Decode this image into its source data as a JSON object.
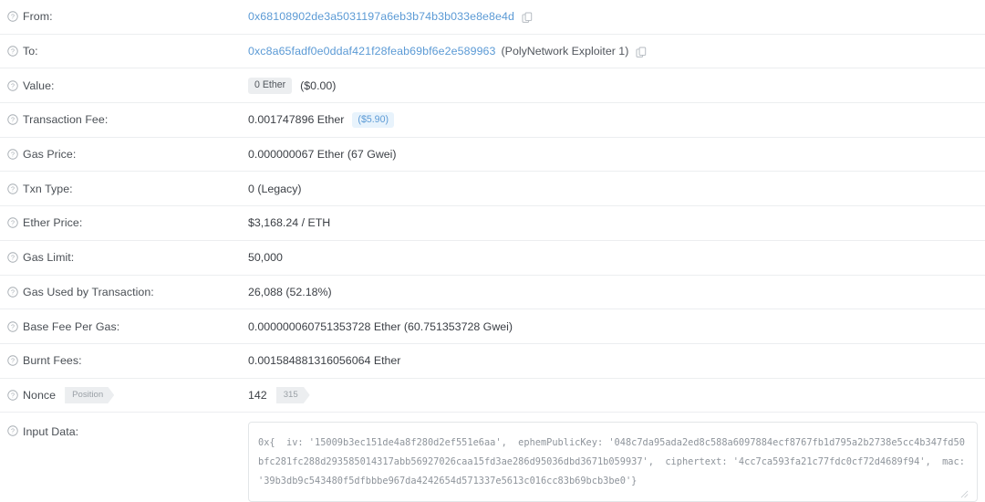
{
  "icons": {
    "help": "question-circle-icon",
    "copy": "copy-icon"
  },
  "rows": {
    "from": {
      "label": "From:",
      "address": "0x68108902de3a5031197a6eb3b74b3b033e8e8e4d"
    },
    "to": {
      "label": "To:",
      "address": "0xc8a65fadf0e0ddaf421f28feab69bf6e2e589963",
      "name_tag": "(PolyNetwork Exploiter 1)"
    },
    "value": {
      "label": "Value:",
      "amount_badge": "0 Ether",
      "usd": "($0.00)"
    },
    "transaction_fee": {
      "label": "Transaction Fee:",
      "amount": "0.001747896 Ether",
      "usd_badge": "($5.90)"
    },
    "gas_price": {
      "label": "Gas Price:",
      "value": "0.000000067 Ether (67 Gwei)"
    },
    "txn_type": {
      "label": "Txn Type:",
      "value": "0 (Legacy)"
    },
    "ether_price": {
      "label": "Ether Price:",
      "value": "$3,168.24 / ETH"
    },
    "gas_limit": {
      "label": "Gas Limit:",
      "value": "50,000"
    },
    "gas_used": {
      "label": "Gas Used by Transaction:",
      "value": "26,088 (52.18%)"
    },
    "base_fee": {
      "label": "Base Fee Per Gas:",
      "value": "0.000000060751353728 Ether (60.751353728 Gwei)"
    },
    "burnt_fees": {
      "label": "Burnt Fees:",
      "value": "0.001584881316056064 Ether"
    },
    "nonce": {
      "label": "Nonce",
      "position_badge": "Position",
      "value": "142",
      "index_badge": "315"
    },
    "input_data": {
      "label": "Input Data:",
      "value": "0x{  iv: '15009b3ec151de4a8f280d2ef551e6aa',  ephemPublicKey: '048c7da95ada2ed8c588a6097884ecf8767fb1d795a2b2738e5cc4b347fd50bfc281fc288d293585014317abb56927026caa15fd3ae286d95036dbd3671b059937',  ciphertext: '4cc7ca593fa21c77fdc0cf72d4689f94',  mac: '39b3db9c543480f5dfbbbe967da4242654d571337e5613c016cc83b69bcb3be0'}"
    }
  },
  "colors": {
    "link": "#5b9ad5",
    "badge_grey_bg": "#eceef0",
    "badge_blue_bg": "#e8f3fc",
    "row_border": "#eceef0",
    "text": "#3b3f45"
  }
}
